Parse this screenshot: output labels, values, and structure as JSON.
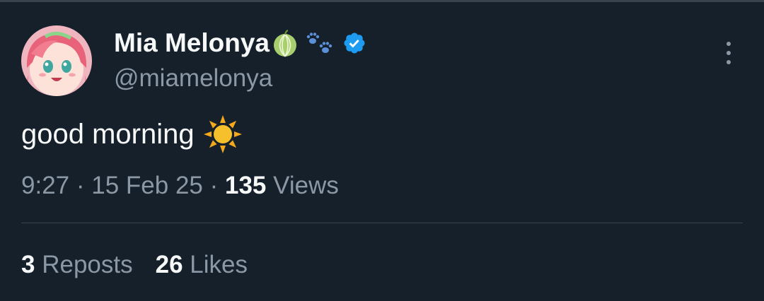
{
  "author": {
    "display_name": "Mia Melonya",
    "handle": "@miamelonya",
    "name_emojis": [
      "melon-icon",
      "paw-prints-icon"
    ],
    "verified": true,
    "verified_color": "#1d9bf0"
  },
  "tweet": {
    "text": "good morning",
    "trailing_emoji": "sun-icon"
  },
  "meta": {
    "time": "9:27",
    "separator": "·",
    "date": "15 Feb 25",
    "views_count": "135",
    "views_label": "Views"
  },
  "stats": {
    "reposts_count": "3",
    "reposts_label": "Reposts",
    "likes_count": "26",
    "likes_label": "Likes"
  },
  "colors": {
    "background": "#15202b",
    "primary_text": "#f7f9f9",
    "secondary_text": "#8b98a5",
    "divider": "#38444d",
    "accent": "#1d9bf0"
  }
}
